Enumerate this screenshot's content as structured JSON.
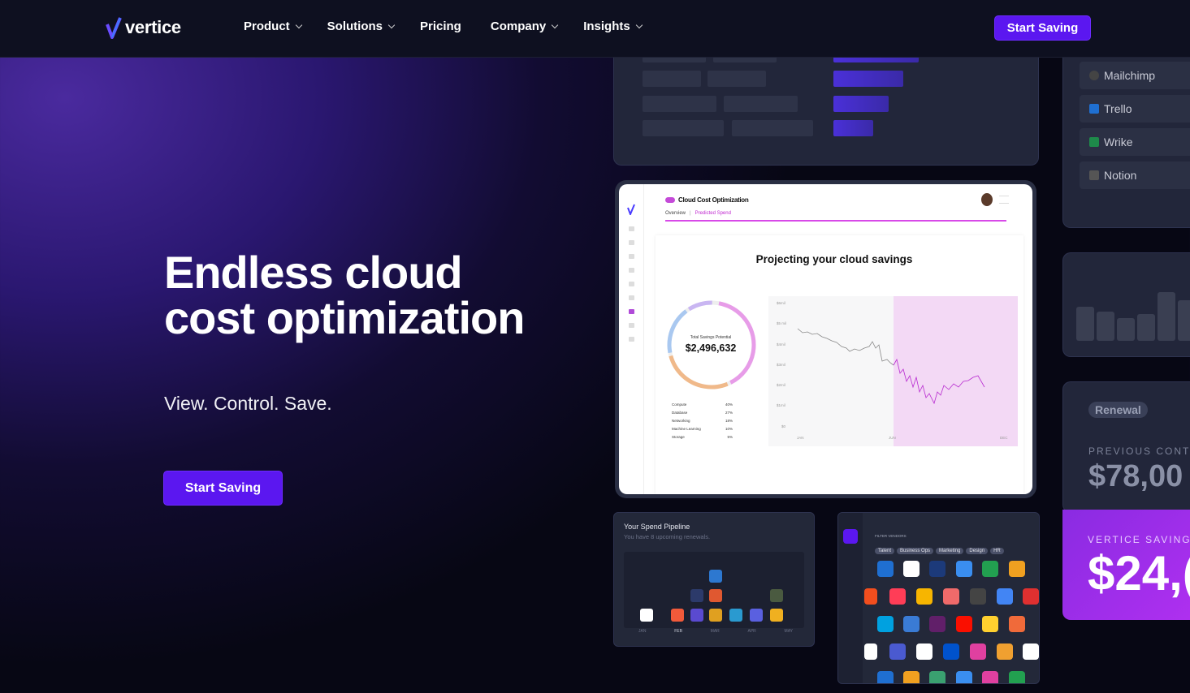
{
  "brand": {
    "name": "vertice",
    "accent": "#5b17f0"
  },
  "nav": {
    "items": [
      {
        "label": "Product",
        "has_dropdown": true
      },
      {
        "label": "Solutions",
        "has_dropdown": true
      },
      {
        "label": "Pricing",
        "has_dropdown": false
      },
      {
        "label": "Company",
        "has_dropdown": true
      },
      {
        "label": "Insights",
        "has_dropdown": true
      }
    ],
    "cta": "Start Saving"
  },
  "hero": {
    "title_line1": "Endless cloud",
    "title_line2": "cost optimization",
    "subtitle": "View. Control. Save.",
    "cta": "Start Saving"
  },
  "tools_list": [
    "Mailchimp",
    "Trello",
    "Wrike",
    "Notion"
  ],
  "dashboard": {
    "app_title": "Cloud Cost Optimization",
    "tab_overview": "Overview",
    "tab_predicted": "Predicted Spend",
    "heading": "Projecting your cloud savings",
    "donut_label": "Total Savings Potential",
    "donut_value": "$2,496,632",
    "breakdown": [
      {
        "name": "Compute",
        "pct": "40%"
      },
      {
        "name": "Database",
        "pct": "27%"
      },
      {
        "name": "Networking",
        "pct": "18%"
      },
      {
        "name": "Machine Learning",
        "pct": "10%"
      },
      {
        "name": "Storage",
        "pct": "5%"
      }
    ],
    "y_ticks": [
      "$6mil",
      "$5 mil",
      "$4mil",
      "$3mil",
      "$2mil",
      "$1mil",
      "$0"
    ],
    "x_ticks": [
      "JAN",
      "JUN",
      "DEC"
    ]
  },
  "pipeline": {
    "title": "Your Spend Pipeline",
    "subtitle": "You have 8 upcoming renewals.",
    "months": [
      "JAN",
      "FEB",
      "MAR",
      "APR",
      "MAY"
    ]
  },
  "vendors": {
    "filter_label": "FILTER VENDORS",
    "filters": [
      "Talent",
      "Business Ops",
      "Marketing",
      "Design",
      "HR"
    ]
  },
  "renewal": {
    "badge": "Renewal",
    "prev_label": "PREVIOUS CONTRA",
    "prev_value": "$78,00",
    "savings_label": "VERTICE SAVINGS",
    "savings_value": "$24,("
  }
}
